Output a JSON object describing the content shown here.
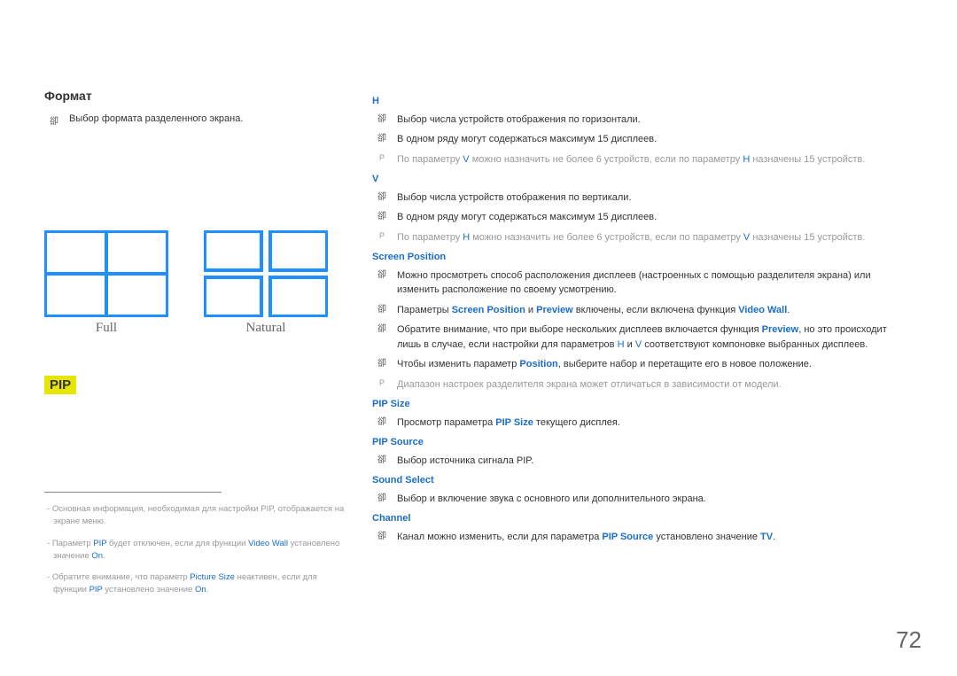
{
  "left": {
    "title": "Формат",
    "bullet": "Выбор формата разделенного экрана.",
    "diag_full": "Full",
    "diag_natural": "Natural",
    "pip_badge": "PIP",
    "footnotes": {
      "f1_a": "Основная информация, необходимая для настройки PIP, отображается на экране меню.",
      "f2_a": "Параметр ",
      "f2_pip": "PIP",
      "f2_b": " будет отключен, если для функции ",
      "f2_vw": "Video Wall",
      "f2_c": " установлено значение ",
      "f2_on": "On",
      "f2_d": ".",
      "f3_a": "Обратите внимание, что параметр ",
      "f3_ps": "Picture Size",
      "f3_b": " неактивен, если для функции ",
      "f3_pip": "PIP",
      "f3_c": " установлено значение ",
      "f3_on": "On",
      "f3_d": "."
    }
  },
  "right": {
    "h_label": "H",
    "h_b1": "Выбор числа устройств отображения по горизонтали.",
    "h_b2": "В одном ряду могут содержаться максимум 15 дисплеев.",
    "h_note_a": "По параметру ",
    "h_note_v": "V",
    "h_note_b": " можно назначить не более 6 устройств, если по параметру ",
    "h_note_h": "H",
    "h_note_c": " назначены 15 устройств.",
    "v_label": "V",
    "v_b1": "Выбор числа устройств отображения по вертикали.",
    "v_b2": "В одном ряду могут содержаться максимум 15 дисплеев.",
    "v_note_a": "По параметру ",
    "v_note_h": "H",
    "v_note_b": " можно назначить не более 6 устройств, если по параметру ",
    "v_note_v": "V",
    "v_note_c": " назначены 15 устройств.",
    "sp_label": "Screen Position",
    "sp_b1": "Можно просмотреть способ расположения дисплеев (настроенных с помощью разделителя экрана) или изменить расположение по своему усмотрению.",
    "sp_b2_a": "Параметры ",
    "sp_b2_sp": "Screen Position",
    "sp_b2_b": " и ",
    "sp_b2_pr": "Preview",
    "sp_b2_c": " включены, если включена функция ",
    "sp_b2_vw": "Video Wall",
    "sp_b2_d": ".",
    "sp_b3_a": "Обратите внимание, что при выборе нескольких дисплеев включается функция ",
    "sp_b3_pr": "Preview",
    "sp_b3_b": ", но это происходит лишь в случае, если настройки для параметров ",
    "sp_b3_h": "H",
    "sp_b3_c": " и ",
    "sp_b3_v": "V",
    "sp_b3_d": " соответствуют компоновке выбранных дисплеев.",
    "sp_b4_a": "Чтобы изменить параметр ",
    "sp_b4_pos": "Position",
    "sp_b4_b": ", выберите набор и перетащите его в новое положение.",
    "sp_note": "Диапазон настроек разделителя экрана может отличаться в зависимости от модели.",
    "pipsize_label": "PIP Size",
    "pipsize_b_a": "Просмотр параметра ",
    "pipsize_b_ps": "PIP Size",
    "pipsize_b_b": " текущего дисплея.",
    "pipsrc_label": "PIP Source",
    "pipsrc_b": "Выбор источника сигнала PIP.",
    "ss_label": "Sound Select",
    "ss_b": "Выбор и включение звука с основного или дополнительного экрана.",
    "ch_label": "Channel",
    "ch_b_a": "Канал можно изменить, если для параметра ",
    "ch_b_ps": "PIP Source",
    "ch_b_b": " установлено значение ",
    "ch_b_tv": "TV",
    "ch_b_c": "."
  },
  "page_number": "72"
}
